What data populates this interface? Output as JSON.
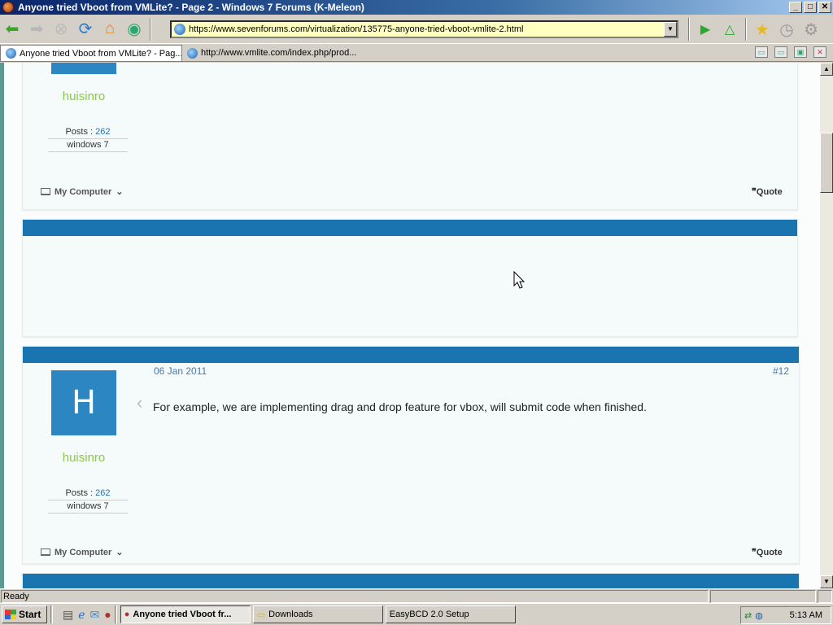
{
  "window": {
    "title": "Anyone tried Vboot from VMLite? - Page 2 - Windows 7 Forums (K-Meleon)",
    "min": "_",
    "max": "□",
    "close": "✕"
  },
  "toolbar": {
    "url": "https://www.sevenforums.com/virtualization/135775-anyone-tried-vboot-vmlite-2.html",
    "dropdown": "▼"
  },
  "tabs": [
    {
      "label": "Anyone tried Vboot from VMLite? - Pag..."
    },
    {
      "label": "http://www.vmlite.com/index.php/prod..."
    }
  ],
  "posts": [
    {
      "username": "huisinro",
      "posts_label": "Posts : ",
      "posts_value": "262",
      "os": "windows 7",
      "my_computer": "My Computer",
      "quote": "Quote"
    },
    {
      "date": "06 Jan 2011",
      "number": "#12",
      "avatar_letter": "H",
      "message": "For example, we are implementing drag and drop feature for vbox, will submit code when finished.",
      "username": "huisinro",
      "posts_label": "Posts : ",
      "posts_value": "262",
      "os": "windows 7",
      "my_computer": "My Computer",
      "quote": "Quote"
    }
  ],
  "statusbar": {
    "text": "Ready"
  },
  "taskbar": {
    "start": "Start",
    "tasks": [
      {
        "label": "Anyone tried Vboot fr..."
      },
      {
        "label": "Downloads"
      },
      {
        "label": "EasyBCD 2.0 Setup"
      }
    ],
    "clock": "5:13 AM"
  }
}
